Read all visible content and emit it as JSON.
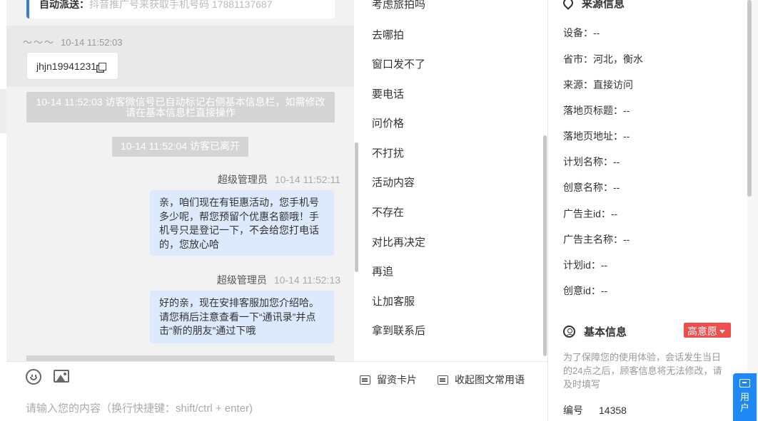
{
  "chat": {
    "top_card": {
      "label": "自动派送：",
      "text": "抖音推广号来获取手机号码 17881137687"
    },
    "visitor_name": "～～～",
    "visitor_time": "10-14 11:52:03",
    "visitor_card_text": "jhjn19941231",
    "system_notes": [
      "10-14 11:52:03 访客微信号已自动标记右侧基本信息栏，如需修改请在基本信息栏直接操作",
      "10-14 11:52:04 访客已离开"
    ],
    "agent_messages": [
      {
        "name": "超级管理员",
        "time": "10-14 11:52:11",
        "text": "亲，咱们现在有钜惠活动，您手机号多少呢，帮您预留个优惠名额哦！手机号只是登记一下，不会给您打电话的，您放心哈"
      },
      {
        "name": "超级管理员",
        "time": "10-14 11:52:13",
        "text": "好的亲，现在安排客服加您介绍哈。请您稍后注意查看一下“通讯录”并点击“新的朋友”通过下哦"
      }
    ]
  },
  "input": {
    "placeholder": "请输入您的内容（换行快捷键：shift/ctrl + enter)",
    "actions": {
      "card": "留资卡片",
      "collapse": "收起图文常用语"
    }
  },
  "quick_replies": [
    "考虑旅拍吗",
    "去哪拍",
    "窗口发不了",
    "要电话",
    "问价格",
    "不打扰",
    "活动内容",
    "不存在",
    "对比再决定",
    "再追",
    "让加客服",
    "拿到联系后"
  ],
  "source_info": {
    "title": "来源信息",
    "rows": [
      "设备：--",
      "省市：河北，衡水",
      "来源：直接访问",
      "落地页标题：--",
      "落地页地址：--",
      "计划名称：--",
      "创意名称：--",
      "广告主id：--",
      "广告主名称：--",
      "计划id：--",
      "创意id：--"
    ]
  },
  "basic_info": {
    "title": "基本信息",
    "intent_tag": "高意愿",
    "notice": "为了保障您的使用体验，会话发生当日的24点之后，顾客信息将无法修改，请及时填写",
    "id_label": "编号",
    "id_value": "14358"
  },
  "float_button": {
    "label_line1": "用",
    "label_line2": "户"
  },
  "colors": {
    "bubble": "#dde9fd",
    "system_note": "#d4d4d4",
    "tag": "#f04d4d",
    "float_button": "#1e88f5",
    "accent": "#3a7bd5"
  },
  "icons": [
    "emoji-icon",
    "image-icon",
    "card-icon",
    "collapse-icon",
    "location-pin-icon",
    "user-circle-icon",
    "copy-icon",
    "chat-icon"
  ]
}
